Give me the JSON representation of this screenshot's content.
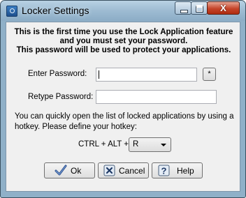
{
  "window": {
    "title": "Locker Settings",
    "controls": {
      "minimize": "minimize",
      "maximize": "maximize",
      "close": "X"
    }
  },
  "intro": {
    "line1": "This is the first time you use the Lock Application feature",
    "line2": "and you must set your password.",
    "line3": "This password will be used to protect your applications."
  },
  "password": {
    "enter_label": "Enter Password:",
    "enter_value": "",
    "retype_label": "Retype Password:",
    "retype_value": "",
    "reveal_button": "*"
  },
  "hotkey": {
    "hint_line1": "You can quickly open the list of locked applications by using a",
    "hint_line2": "hotkey. Please define your hotkey:",
    "prefix": "CTRL + ALT +",
    "selected_key": "R"
  },
  "buttons": {
    "ok": "Ok",
    "cancel": "Cancel",
    "help": "Help"
  },
  "icons": {
    "app": "lock-app-icon",
    "ok": "checkmark-icon",
    "cancel": "x-icon",
    "help": "question-icon"
  },
  "colors": {
    "title_bar": "#9dbbd2",
    "close_button": "#c5452a",
    "dialog_face": "#f0f0f0"
  }
}
